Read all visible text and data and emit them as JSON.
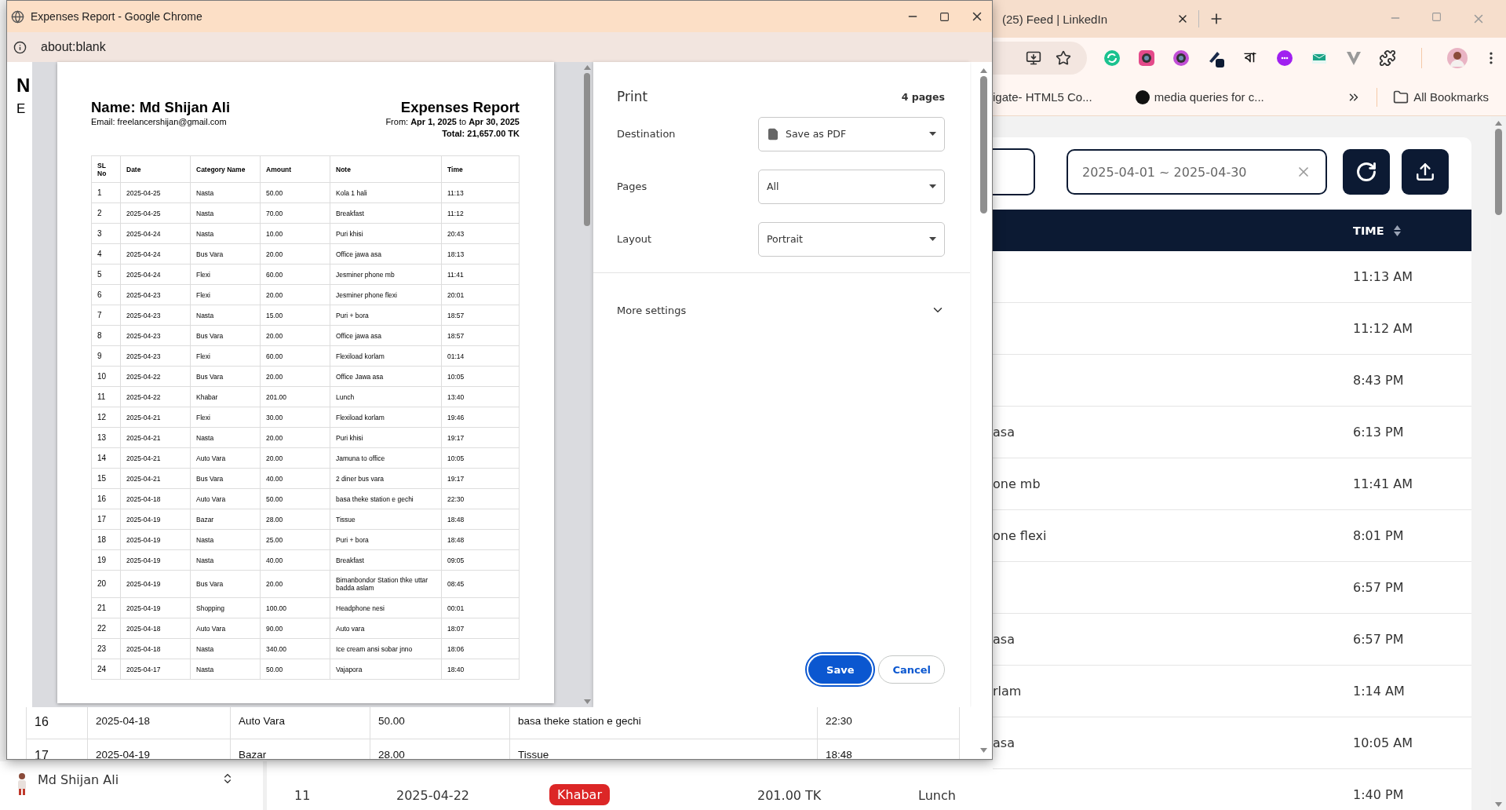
{
  "popup": {
    "title": "Expenses Report - Google Chrome",
    "address": "about:blank",
    "page_fragment": {
      "heading": "N",
      "subheading": "E"
    },
    "preview": {
      "name": "Name: Md Shijan Ali",
      "email": "Email: freelancershijan@gmail.com",
      "title": "Expenses Report",
      "range": "From: **Apr 1, 2025** to **Apr 30, 2025**",
      "total": "Total: 21,657.00 TK",
      "columns": [
        "SL No",
        "Date",
        "Category Name",
        "Amount",
        "Note",
        "Time"
      ],
      "rows": [
        [
          "1",
          "2025-04-25",
          "Nasta",
          "50.00",
          "Kola 1 hali",
          "11:13"
        ],
        [
          "2",
          "2025-04-25",
          "Nasta",
          "70.00",
          "Breakfast",
          "11:12"
        ],
        [
          "3",
          "2025-04-24",
          "Nasta",
          "10.00",
          "Puri khisi",
          "20:43"
        ],
        [
          "4",
          "2025-04-24",
          "Bus Vara",
          "20.00",
          "Office jawa asa",
          "18:13"
        ],
        [
          "5",
          "2025-04-24",
          "Flexi",
          "60.00",
          "Jesminer phone mb",
          "11:41"
        ],
        [
          "6",
          "2025-04-23",
          "Flexi",
          "20.00",
          "Jesminer phone flexi",
          "20:01"
        ],
        [
          "7",
          "2025-04-23",
          "Nasta",
          "15.00",
          "Puri + bora",
          "18:57"
        ],
        [
          "8",
          "2025-04-23",
          "Bus Vara",
          "20.00",
          "Office jawa asa",
          "18:57"
        ],
        [
          "9",
          "2025-04-23",
          "Flexi",
          "60.00",
          "Flexiload korlam",
          "01:14"
        ],
        [
          "10",
          "2025-04-22",
          "Bus Vara",
          "20.00",
          "Office Jawa asa",
          "10:05"
        ],
        [
          "11",
          "2025-04-22",
          "Khabar",
          "201.00",
          "Lunch",
          "13:40"
        ],
        [
          "12",
          "2025-04-21",
          "Flexi",
          "30.00",
          "Flexiload korlam",
          "19:46"
        ],
        [
          "13",
          "2025-04-21",
          "Nasta",
          "20.00",
          "Puri khisi",
          "19:17"
        ],
        [
          "14",
          "2025-04-21",
          "Auto Vara",
          "20.00",
          "Jamuna to office",
          "10:05"
        ],
        [
          "15",
          "2025-04-21",
          "Bus Vara",
          "40.00",
          "2 diner bus vara",
          "19:17"
        ],
        [
          "16",
          "2025-04-18",
          "Auto Vara",
          "50.00",
          "basa theke station e gechi",
          "22:30"
        ],
        [
          "17",
          "2025-04-19",
          "Bazar",
          "28.00",
          "Tissue",
          "18:48"
        ],
        [
          "18",
          "2025-04-19",
          "Nasta",
          "25.00",
          "Puri + bora",
          "18:48"
        ],
        [
          "19",
          "2025-04-19",
          "Nasta",
          "40.00",
          "Breakfast",
          "09:05"
        ],
        [
          "20",
          "2025-04-19",
          "Bus Vara",
          "20.00",
          "Bimanbondor Station thke uttar badda aslam",
          "08:45"
        ],
        [
          "21",
          "2025-04-19",
          "Shopping",
          "100.00",
          "Headphone nesi",
          "00:01"
        ],
        [
          "22",
          "2025-04-18",
          "Auto Vara",
          "90.00",
          "Auto vara",
          "18:07"
        ],
        [
          "23",
          "2025-04-18",
          "Nasta",
          "340.00",
          "Ice cream ansi sobar jnno",
          "18:06"
        ],
        [
          "24",
          "2025-04-17",
          "Nasta",
          "50.00",
          "Vajapora",
          "18:40"
        ]
      ]
    },
    "print": {
      "title": "Print",
      "pages_count": "4 pages",
      "settings": [
        {
          "label": "Destination",
          "value": "Save as PDF",
          "kind": "destination"
        },
        {
          "label": "Pages",
          "value": "All",
          "kind": "select"
        },
        {
          "label": "Layout",
          "value": "Portrait",
          "kind": "select"
        }
      ],
      "more_settings": {
        "label": "More settings",
        "expanded": false
      },
      "buttons": [
        {
          "label": "Save",
          "primary": true
        },
        {
          "label": "Cancel",
          "primary": false
        }
      ]
    },
    "page_rows": [
      [
        "16",
        "2025-04-18",
        "Auto Vara",
        "50.00",
        "basa theke station e gechi",
        "22:30"
      ],
      [
        "17",
        "2025-04-19",
        "Bazar",
        "28.00",
        "Tissue",
        "18:48"
      ]
    ]
  },
  "browser": {
    "tab": "(25) Feed | LinkedIn",
    "extension_label": "বা",
    "bookmarks": [
      {
        "label": "igate- HTML5 Co...",
        "kind": "text"
      },
      {
        "label": "media queries for c...",
        "kind": "favicon"
      }
    ],
    "all_bookmarks": "All Bookmarks"
  },
  "app": {
    "date_range": "2025-04-01 ~ 2025-04-30",
    "time_header": "TIME",
    "rows": [
      {
        "time": "11:13 AM"
      },
      {
        "time": "11:12 AM"
      },
      {
        "time": "8:43 PM"
      },
      {
        "note": "asa",
        "time": "6:13 PM"
      },
      {
        "note": "one mb",
        "time": "11:41 AM"
      },
      {
        "note": "one flexi",
        "time": "8:01 PM"
      },
      {
        "time": "6:57 PM"
      },
      {
        "note": "asa",
        "time": "6:57 PM"
      },
      {
        "note": "rlam",
        "time": "1:14 AM"
      },
      {
        "note": "asa",
        "time": "10:05 AM"
      },
      {
        "time": "1:40 PM"
      }
    ],
    "bottom_row": {
      "sl": "11",
      "date": "2025-04-22",
      "category": "Khabar",
      "amount": "201.00 TK",
      "note": "Lunch"
    },
    "user": "Md Shijan Ali"
  }
}
